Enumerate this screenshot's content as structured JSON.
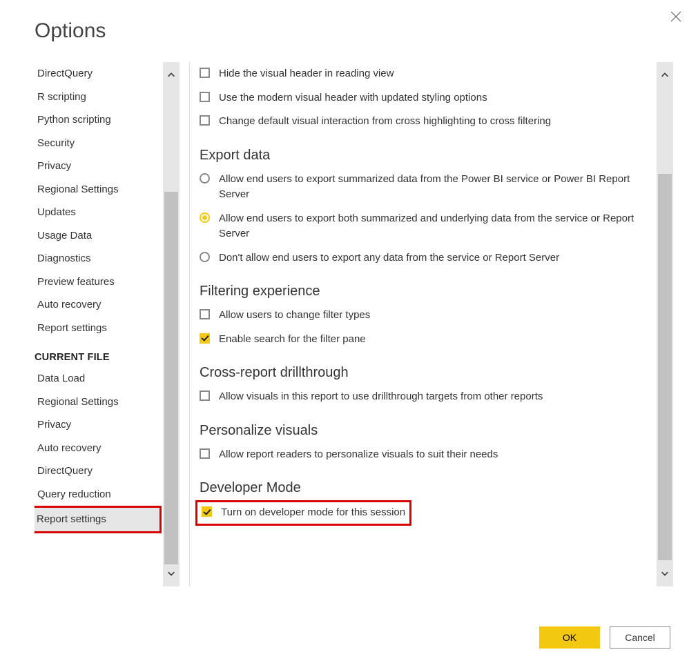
{
  "title": "Options",
  "sidebar": {
    "global_items": [
      {
        "label": "DirectQuery"
      },
      {
        "label": "R scripting"
      },
      {
        "label": "Python scripting"
      },
      {
        "label": "Security"
      },
      {
        "label": "Privacy"
      },
      {
        "label": "Regional Settings"
      },
      {
        "label": "Updates"
      },
      {
        "label": "Usage Data"
      },
      {
        "label": "Diagnostics"
      },
      {
        "label": "Preview features"
      },
      {
        "label": "Auto recovery"
      },
      {
        "label": "Report settings"
      }
    ],
    "section_header": "CURRENT FILE",
    "file_items": [
      {
        "label": "Data Load"
      },
      {
        "label": "Regional Settings"
      },
      {
        "label": "Privacy"
      },
      {
        "label": "Auto recovery"
      },
      {
        "label": "DirectQuery"
      },
      {
        "label": "Query reduction"
      },
      {
        "label": "Report settings",
        "selected": true
      }
    ]
  },
  "main": {
    "visual_options": [
      {
        "label": "Hide the visual header in reading view",
        "checked": false
      },
      {
        "label": "Use the modern visual header with updated styling options",
        "checked": false
      },
      {
        "label": "Change default visual interaction from cross highlighting to cross filtering",
        "checked": false
      }
    ],
    "export": {
      "title": "Export data",
      "options": [
        {
          "label": "Allow end users to export summarized data from the Power BI service or Power BI Report Server",
          "selected": false
        },
        {
          "label": "Allow end users to export both summarized and underlying data from the service or Report Server",
          "selected": true
        },
        {
          "label": "Don't allow end users to export any data from the service or Report Server",
          "selected": false
        }
      ]
    },
    "filtering": {
      "title": "Filtering experience",
      "options": [
        {
          "label": "Allow users to change filter types",
          "checked": false
        },
        {
          "label": "Enable search for the filter pane",
          "checked": true
        }
      ]
    },
    "cross_report": {
      "title": "Cross-report drillthrough",
      "options": [
        {
          "label": "Allow visuals in this report to use drillthrough targets from other reports",
          "checked": false
        }
      ]
    },
    "personalize": {
      "title": "Personalize visuals",
      "options": [
        {
          "label": "Allow report readers to personalize visuals to suit their needs",
          "checked": false
        }
      ]
    },
    "developer": {
      "title": "Developer Mode",
      "options": [
        {
          "label": "Turn on developer mode for this session",
          "checked": true,
          "highlight": true
        }
      ]
    }
  },
  "footer": {
    "ok": "OK",
    "cancel": "Cancel"
  }
}
